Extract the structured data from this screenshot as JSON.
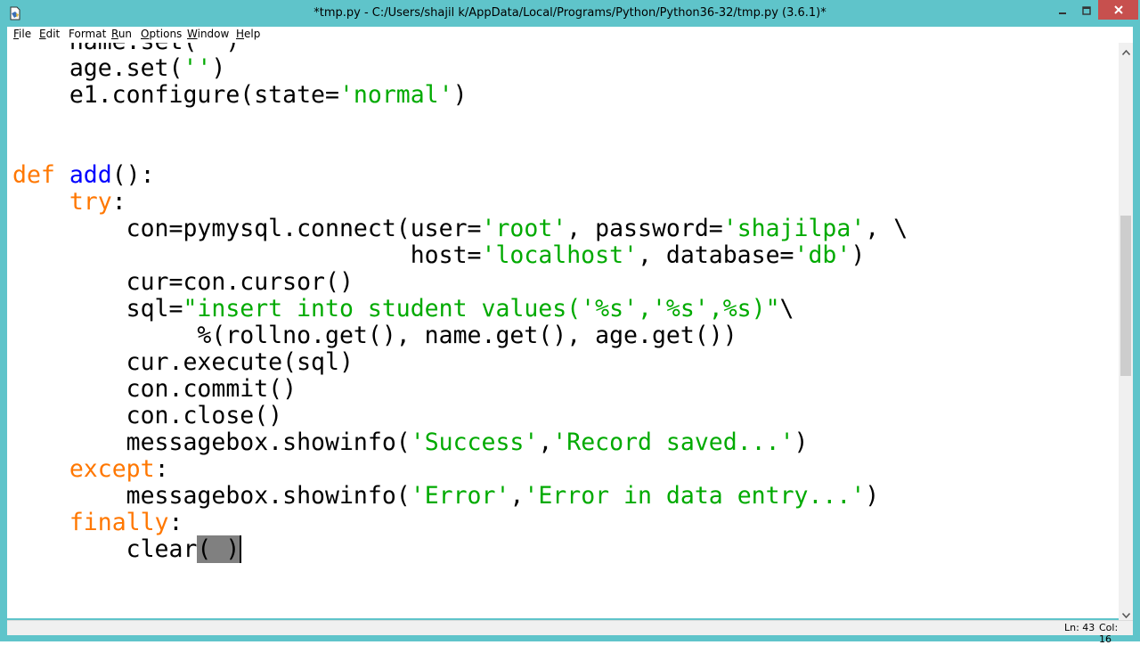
{
  "window": {
    "title": "*tmp.py - C:/Users/shajil k/AppData/Local/Programs/Python/Python36-32/tmp.py (3.6.1)*",
    "frame_color": "#5fc4ca",
    "close_color": "#c7504e"
  },
  "menubar": {
    "items": [
      {
        "key": "F",
        "rest": "ile"
      },
      {
        "key": "E",
        "rest": "dit"
      },
      {
        "key": "",
        "rest": "Format"
      },
      {
        "key": "R",
        "rest": "un"
      },
      {
        "key": "O",
        "rest": "ptions"
      },
      {
        "key": "W",
        "rest": "indow"
      },
      {
        "key": "H",
        "rest": "elp"
      }
    ]
  },
  "editor": {
    "colors": {
      "keyword": "#ff7700",
      "builtin": "#0000ff",
      "string": "#00aa00",
      "selection": "#808080"
    },
    "lines": [
      [
        {
          "t": "    name.set('')",
          "c": "plain"
        }
      ],
      [
        {
          "t": "    age.set(",
          "c": "plain"
        },
        {
          "t": "''",
          "c": "str"
        },
        {
          "t": ")",
          "c": "plain"
        }
      ],
      [
        {
          "t": "    e1.configure(state=",
          "c": "plain"
        },
        {
          "t": "'normal'",
          "c": "str"
        },
        {
          "t": ")",
          "c": "plain"
        }
      ],
      [
        {
          "t": "",
          "c": "plain"
        }
      ],
      [
        {
          "t": "",
          "c": "plain"
        }
      ],
      [
        {
          "t": "def ",
          "c": "kw"
        },
        {
          "t": "add",
          "c": "fn"
        },
        {
          "t": "():",
          "c": "plain"
        }
      ],
      [
        {
          "t": "    ",
          "c": "plain"
        },
        {
          "t": "try",
          "c": "kw"
        },
        {
          "t": ":",
          "c": "plain"
        }
      ],
      [
        {
          "t": "        con=pymysql.connect(user=",
          "c": "plain"
        },
        {
          "t": "'root'",
          "c": "str"
        },
        {
          "t": ", password=",
          "c": "plain"
        },
        {
          "t": "'shajilpa'",
          "c": "str"
        },
        {
          "t": ", \\",
          "c": "plain"
        }
      ],
      [
        {
          "t": "                            host=",
          "c": "plain"
        },
        {
          "t": "'localhost'",
          "c": "str"
        },
        {
          "t": ", database=",
          "c": "plain"
        },
        {
          "t": "'db'",
          "c": "str"
        },
        {
          "t": ")",
          "c": "plain"
        }
      ],
      [
        {
          "t": "        cur=con.cursor()",
          "c": "plain"
        }
      ],
      [
        {
          "t": "        sql=",
          "c": "plain"
        },
        {
          "t": "\"insert into student values('%s','%s',%s)\"",
          "c": "str"
        },
        {
          "t": "\\",
          "c": "plain"
        }
      ],
      [
        {
          "t": "             %(rollno.get(), name.get(), age.get())",
          "c": "plain"
        }
      ],
      [
        {
          "t": "        cur.execute(sql)",
          "c": "plain"
        }
      ],
      [
        {
          "t": "        con.commit()",
          "c": "plain"
        }
      ],
      [
        {
          "t": "        con.close()",
          "c": "plain"
        }
      ],
      [
        {
          "t": "        messagebox.showinfo(",
          "c": "plain"
        },
        {
          "t": "'Success'",
          "c": "str"
        },
        {
          "t": ",",
          "c": "plain"
        },
        {
          "t": "'Record saved...'",
          "c": "str"
        },
        {
          "t": ")",
          "c": "plain"
        }
      ],
      [
        {
          "t": "    ",
          "c": "plain"
        },
        {
          "t": "except",
          "c": "kw"
        },
        {
          "t": ":",
          "c": "plain"
        }
      ],
      [
        {
          "t": "        messagebox.showinfo(",
          "c": "plain"
        },
        {
          "t": "'Error'",
          "c": "str"
        },
        {
          "t": ",",
          "c": "plain"
        },
        {
          "t": "'Error in data entry...'",
          "c": "str"
        },
        {
          "t": ")",
          "c": "plain"
        }
      ],
      [
        {
          "t": "    ",
          "c": "plain"
        },
        {
          "t": "finally",
          "c": "kw"
        },
        {
          "t": ":",
          "c": "plain"
        }
      ],
      [
        {
          "t": "        clear",
          "c": "plain"
        },
        {
          "t": "( )",
          "c": "sel"
        },
        {
          "t": "",
          "c": "caret"
        }
      ]
    ]
  },
  "statusbar": {
    "line": "Ln: 43",
    "col": "Col: 16"
  }
}
